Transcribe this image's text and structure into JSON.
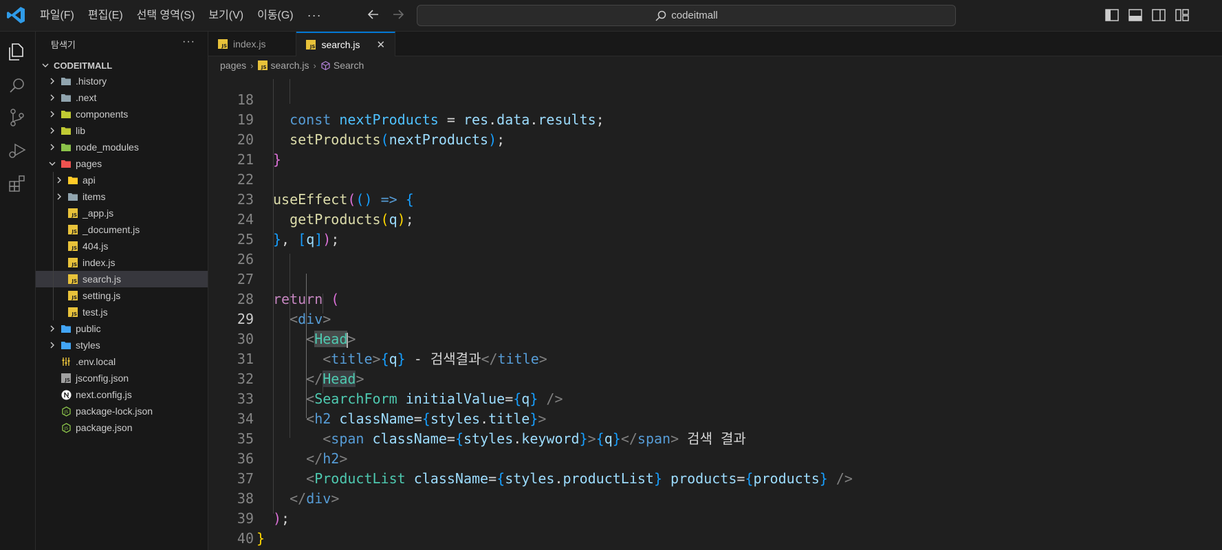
{
  "menu": {
    "items": [
      "파일(F)",
      "편집(E)",
      "선택 영역(S)",
      "보기(V)",
      "이동(G)"
    ],
    "more": "···"
  },
  "search": {
    "label": "codeitmall"
  },
  "sidebar": {
    "title": "탐색기",
    "more": "···",
    "root": "CODEITMALL",
    "items": [
      {
        "label": ".history",
        "icon": "folder-icon",
        "color": "#90a4ae"
      },
      {
        "label": ".next",
        "icon": "folder-next-icon",
        "color": "#90a4ae"
      },
      {
        "label": "components",
        "icon": "folder-components-icon",
        "color": "#c0ca33"
      },
      {
        "label": "lib",
        "icon": "folder-lib-icon",
        "color": "#c0ca33"
      },
      {
        "label": "node_modules",
        "icon": "folder-node-icon",
        "color": "#8bc34a"
      },
      {
        "label": "pages",
        "icon": "folder-pages-icon",
        "color": "#ef5350"
      },
      {
        "label": "api",
        "icon": "folder-api-icon",
        "color": "#ffca28"
      },
      {
        "label": "items",
        "icon": "folder-icon",
        "color": "#90a4ae"
      },
      {
        "label": "_app.js",
        "icon": "js-file-icon"
      },
      {
        "label": "_document.js",
        "icon": "js-file-icon"
      },
      {
        "label": "404.js",
        "icon": "js-file-icon"
      },
      {
        "label": "index.js",
        "icon": "js-file-icon"
      },
      {
        "label": "search.js",
        "icon": "js-file-icon"
      },
      {
        "label": "setting.js",
        "icon": "js-file-icon"
      },
      {
        "label": "test.js",
        "icon": "js-file-icon"
      },
      {
        "label": "public",
        "icon": "folder-public-icon",
        "color": "#42a5f5"
      },
      {
        "label": "styles",
        "icon": "folder-styles-icon",
        "color": "#42a5f5"
      },
      {
        "label": ".env.local",
        "icon": "env-file-icon"
      },
      {
        "label": "jsconfig.json",
        "icon": "json-file-icon"
      },
      {
        "label": "next.config.js",
        "icon": "nextjs-file-icon"
      },
      {
        "label": "package-lock.json",
        "icon": "npm-file-icon"
      },
      {
        "label": "package.json",
        "icon": "npm-file-icon"
      }
    ]
  },
  "tabs": [
    {
      "label": "index.js"
    },
    {
      "label": "search.js"
    }
  ],
  "breadcrumb": [
    "pages",
    "search.js",
    "Search"
  ],
  "editor": {
    "line_numbers": [
      "18",
      "19",
      "20",
      "21",
      "22",
      "23",
      "24",
      "25",
      "26",
      "27",
      "28",
      "29",
      "30",
      "31",
      "32",
      "33",
      "34",
      "35",
      "36",
      "37",
      "38",
      "39",
      "40"
    ],
    "current_line": "29",
    "korean": {
      "title_text": " - 검색결과",
      "result_text": " 검색 결과"
    }
  },
  "colors": {
    "accent": "#0078d4",
    "js_badge": "#e8c23a",
    "selection": "#37373d"
  }
}
